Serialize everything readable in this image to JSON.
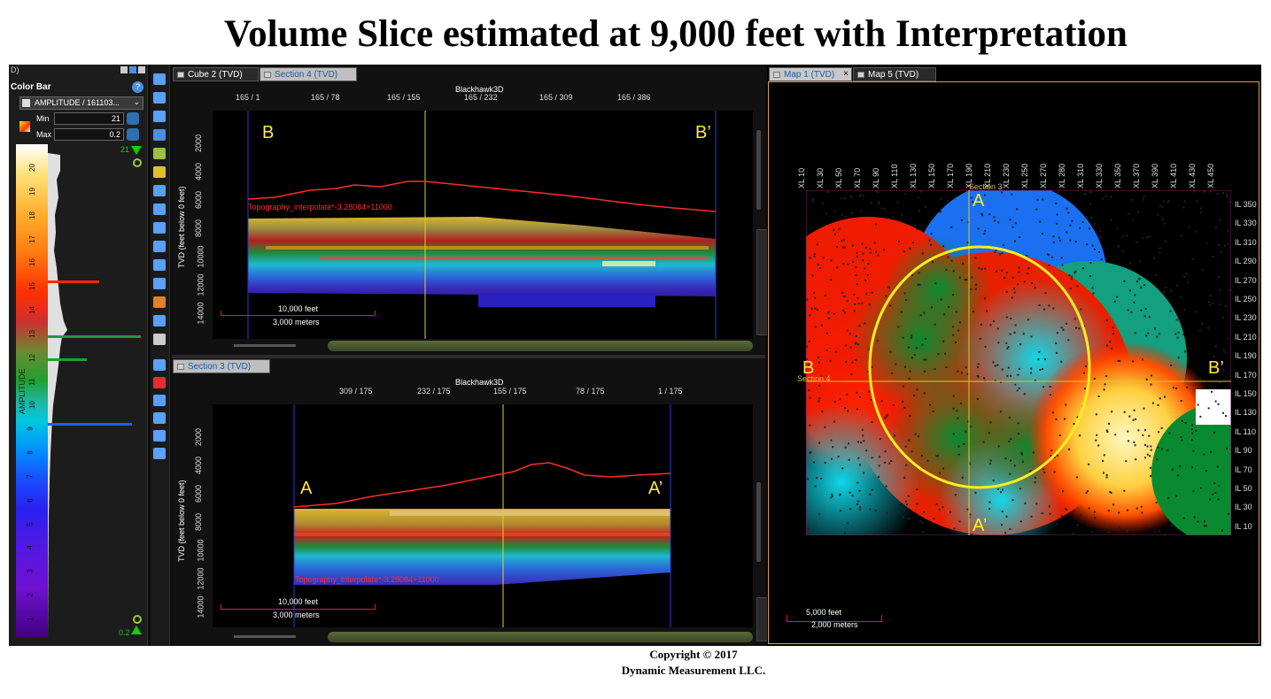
{
  "title": "Volume Slice estimated at 9,000 feet with Interpretation",
  "copyright": {
    "line1": "Copyright  © 2017",
    "line2": "Dynamic Measurement LLC."
  },
  "colorbar": {
    "panel_title": "Color Bar",
    "attribute": "AMPLITUDE / 161103...",
    "min_label": "Min",
    "min_value": "21",
    "max_label": "Max",
    "max_value": "0.2",
    "axis_label": "AMPLITUDE",
    "ticks": [
      "20",
      "19",
      "18",
      "17",
      "16",
      "15",
      "14",
      "13",
      "12",
      "11",
      "10",
      "9",
      "8",
      "7",
      "6",
      "5",
      "4",
      "3",
      "2",
      "1"
    ],
    "top_marker": "21",
    "bottom_marker": "0.2"
  },
  "section4": {
    "tab_inactive": "Cube 2 (TVD)",
    "tab_active": "Section 4 (TVD)",
    "survey": "Blackhawk3D",
    "top_ticks": [
      "165 / 1",
      "165 / 78",
      "165 / 155",
      "165 / 232",
      "165 / 309",
      "165 / 386"
    ],
    "depth_ticks": [
      "2000",
      "4000",
      "6000",
      "8000",
      "10000",
      "12000",
      "14000"
    ],
    "y_label": "TVD (feet below 0 feet)",
    "left_label": "B",
    "right_label": "B’",
    "topo_label": "Topography_interpolate*-3.28084+11000",
    "scale_feet": "10,000 feet",
    "scale_meters": "3,000 meters"
  },
  "section3": {
    "tab_active": "Section 3 (TVD)",
    "survey": "Blackhawk3D",
    "top_ticks": [
      "309 / 175",
      "232 / 175",
      "155 / 175",
      "78 / 175",
      "1 / 175"
    ],
    "depth_ticks": [
      "2000",
      "4000",
      "6000",
      "8000",
      "10000",
      "12000",
      "14000"
    ],
    "y_label": "TVD (feet below 0 feet)",
    "left_label": "A",
    "right_label": "A’",
    "topo_label": "Topography_interpolate*-3.28084+11000",
    "scale_feet": "10,000 feet",
    "scale_meters": "3,000 meters"
  },
  "map": {
    "tab_active": "Map 1 (TVD)",
    "tab_close": "×",
    "tab_inactive": "Map 5 (TVD)",
    "xl_ticks": [
      "XL 10",
      "XL 30",
      "XL 50",
      "XL 70",
      "XL 90",
      "XL 110",
      "XL 130",
      "XL 150",
      "XL 170",
      "XL 190",
      "XL 210",
      "XL 230",
      "XL 250",
      "XL 270",
      "XL 280",
      "XL 310",
      "XL 330",
      "XL 350",
      "XL 370",
      "XL 390",
      "XL 410",
      "XL 430",
      "XL 450"
    ],
    "il_ticks": [
      "IL 350",
      "IL 330",
      "IL 310",
      "IL 290",
      "IL 270",
      "IL 250",
      "IL 230",
      "IL 210",
      "IL 190",
      "IL 170",
      "IL 150",
      "IL 130",
      "IL 110",
      "IL 90",
      "IL 70",
      "IL 50",
      "IL 30",
      "IL 10"
    ],
    "section3_label": "Section 3",
    "section4_label": "Section 4",
    "label_a": "A",
    "label_a2": "A’",
    "label_b": "B",
    "label_b2": "B’",
    "scale_feet": "5,000 feet",
    "scale_meters": "2,000 meters"
  },
  "colors": {
    "accent": "#ffeb3b",
    "topo": "#ff2a2a",
    "border": "#2b3bd6",
    "map_frame": "#e0a030"
  }
}
